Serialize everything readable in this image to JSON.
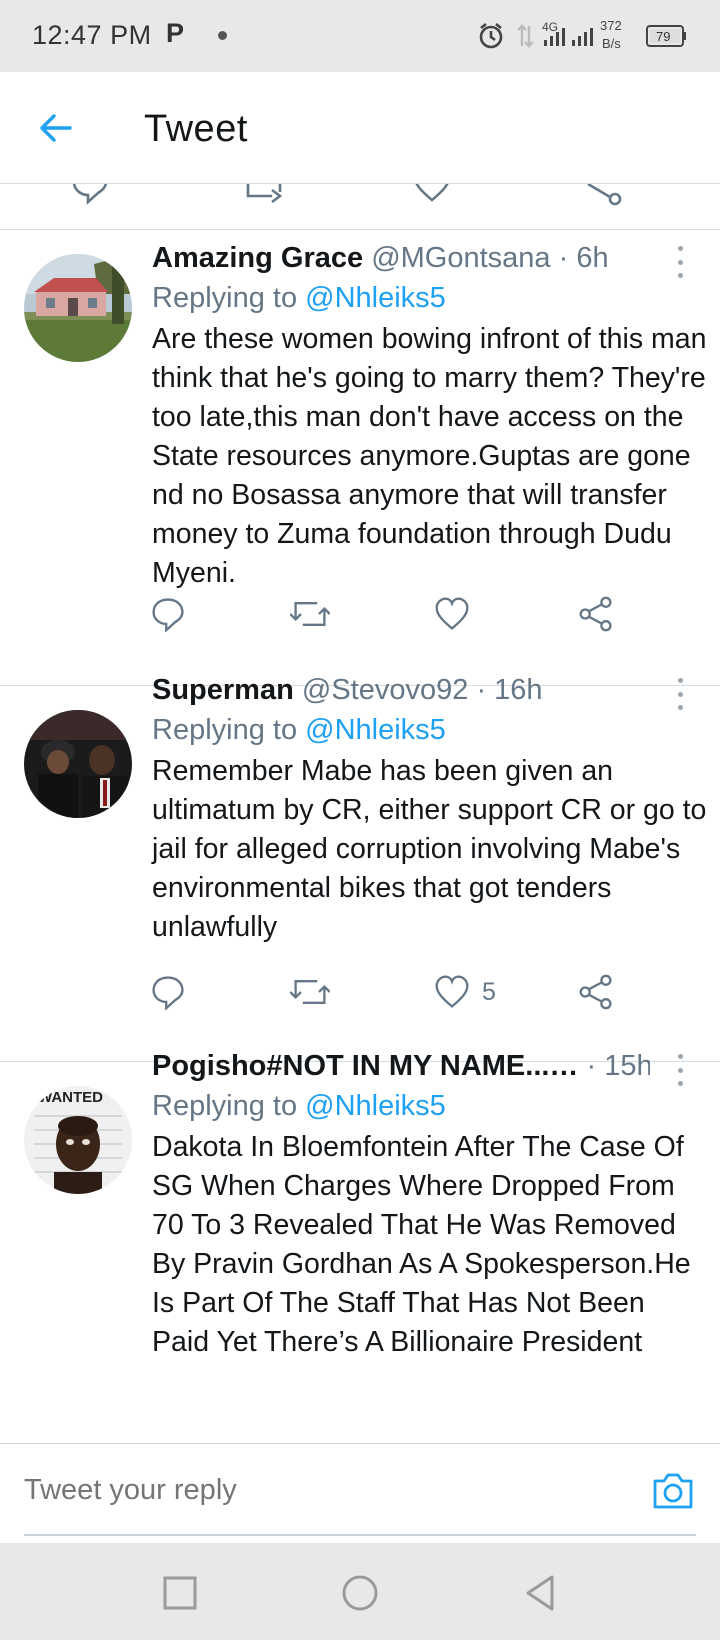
{
  "status_bar": {
    "time": "12:47 PM",
    "carrier_icon": "P",
    "network": "4G",
    "speed_value": "372",
    "speed_unit": "B/s",
    "battery": "79"
  },
  "header": {
    "title": "Tweet"
  },
  "tweets": [
    {
      "name": "Amazing Grace",
      "handle": "@MGontsana",
      "time": "6h",
      "replying_label": "Replying to",
      "replying_to": "@Nhleiks5",
      "text": "Are these women bowing infront of this man think that he's going to marry them? They're too late,this man don't have access on the State resources anymore.Guptas are gone nd no Bosassa anymore that will transfer money to Zuma foundation through Dudu Myeni.",
      "like_count": ""
    },
    {
      "name": "Superman",
      "handle": "@Stevovo92",
      "time": "16h",
      "replying_label": "Replying to",
      "replying_to": "@Nhleiks5",
      "text": "Remember Mabe has been given an ultimatum  by CR, either support CR or go to jail for alleged corruption involving Mabe's environmental bikes that got tenders unlawfully",
      "like_count": "5"
    },
    {
      "name": "Pogisho#NOT IN MY NAME...…",
      "handle": "",
      "time": "15h",
      "replying_label": "Replying to",
      "replying_to": "@Nhleiks5",
      "text": "Dakota In Bloemfontein After The Case Of SG When Charges Where Dropped From 70 To 3 Revealed That He Was Removed By Pravin Gordhan As A Spokesperson.He Is Part Of The Staff That Has Not Been Paid Yet There’s A Billionaire President",
      "avatar_caption": "WANTED"
    }
  ],
  "reply_bar": {
    "placeholder": "Tweet your reply"
  },
  "colors": {
    "accent": "#1da1f2",
    "secondary_text": "#657786",
    "primary_text": "#14171a"
  }
}
